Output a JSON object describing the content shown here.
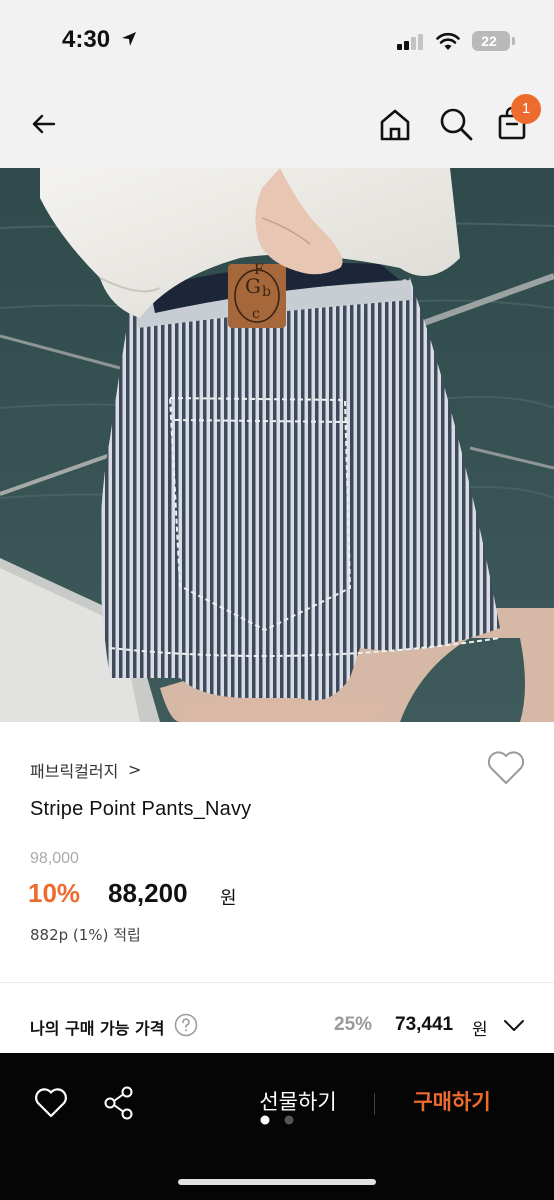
{
  "status_bar": {
    "time": "4:30",
    "battery": "22",
    "icons": [
      "location-arrow-icon",
      "signal-icon",
      "wifi-icon",
      "battery-icon"
    ]
  },
  "app_bar": {
    "icons": [
      "back-arrow-icon",
      "home-icon",
      "search-icon",
      "shopping-bag-icon"
    ],
    "cart_count": "1"
  },
  "image_carousel": {
    "current_index": 1,
    "total": 2
  },
  "product": {
    "brand": "패브릭컬러지",
    "brand_chevron": ">",
    "name": "Stripe Point Pants_Navy",
    "original_price": "98,000",
    "discount_rate": "10%",
    "sale_price": "88,200",
    "currency": "원",
    "points": "882p (1%) 적립"
  },
  "my_price": {
    "label": "나의 구매 가능 가격",
    "discount_rate": "25%",
    "price": "73,441",
    "currency": "원"
  },
  "bottom_bar": {
    "gift_label": "선물하기",
    "buy_label": "구매하기",
    "icons": [
      "heart-outline-icon",
      "share-icon"
    ]
  },
  "colors": {
    "accent": "#ec6b2d",
    "bottom_bar_bg": "#050505",
    "header_bg": "#f2f2f2"
  }
}
